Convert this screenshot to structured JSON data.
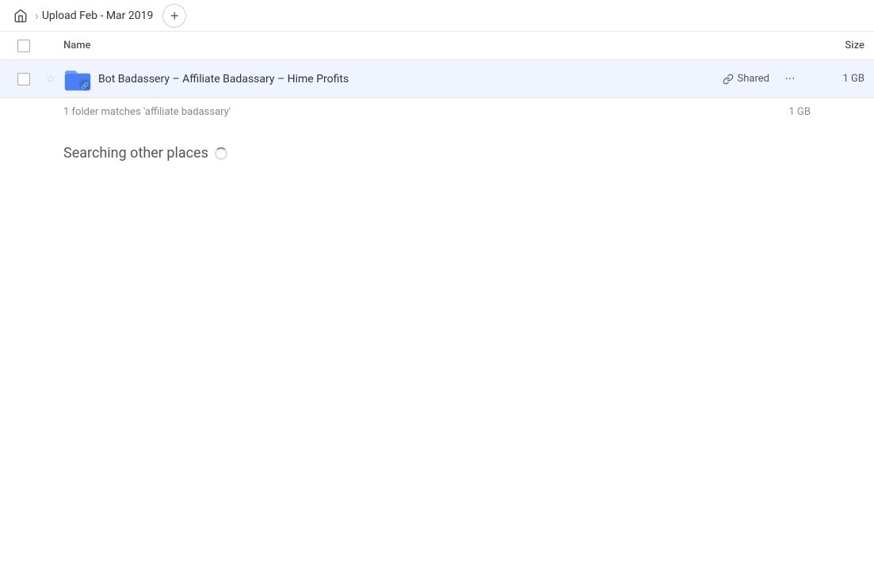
{
  "breadcrumb": {
    "home_icon": "home",
    "separator": "›",
    "title": "Upload Feb - Mar 2019",
    "add_button_label": "+"
  },
  "columns": {
    "name_label": "Name",
    "size_label": "Size"
  },
  "file_row": {
    "name": "Bot Badassery – Affiliate Badassary – Hime Profits",
    "shared_label": "Shared",
    "size": "1 GB",
    "more_icon": "···"
  },
  "match_info": {
    "text": "1 folder matches 'affiliate badassary'",
    "size": "1 GB"
  },
  "searching_section": {
    "label": "Searching other places"
  }
}
